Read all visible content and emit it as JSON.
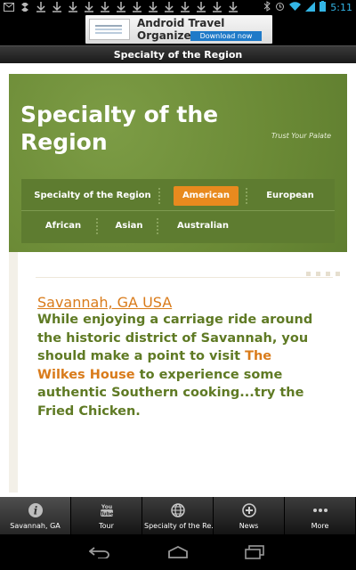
{
  "status_bar": {
    "time": "5:11"
  },
  "ad": {
    "title": "Android Travel Organizer",
    "button": "Download now"
  },
  "header": {
    "title": "Specialty of the Region"
  },
  "banner": {
    "title": "Specialty of the Region",
    "tagline": "Trust Your Palate"
  },
  "nav": {
    "row1": [
      "Specialty of the Region",
      "American",
      "European"
    ],
    "row2": [
      "African",
      "Asian",
      "Australian"
    ],
    "active": "American"
  },
  "article": {
    "location": "Savannah, GA USA",
    "text_before": "While enjoying a carriage ride around the historic district of Savannah, you should make a point to visit ",
    "highlight": "The Wilkes House",
    "text_after": " to experience some authentic Southern cooking...try the Fried Chicken."
  },
  "tabs": [
    {
      "label": "Savannah, GA",
      "icon": "info-icon"
    },
    {
      "label": "Tour",
      "icon": "youtube-icon"
    },
    {
      "label": "Specialty of the Re...",
      "icon": "globe-icon"
    },
    {
      "label": "News",
      "icon": "plus-circle-icon"
    },
    {
      "label": "More",
      "icon": "more-dots-icon"
    }
  ],
  "colors": {
    "green": "#6f8f3a",
    "orange": "#e88a1e",
    "text_green": "#5f7a24"
  }
}
